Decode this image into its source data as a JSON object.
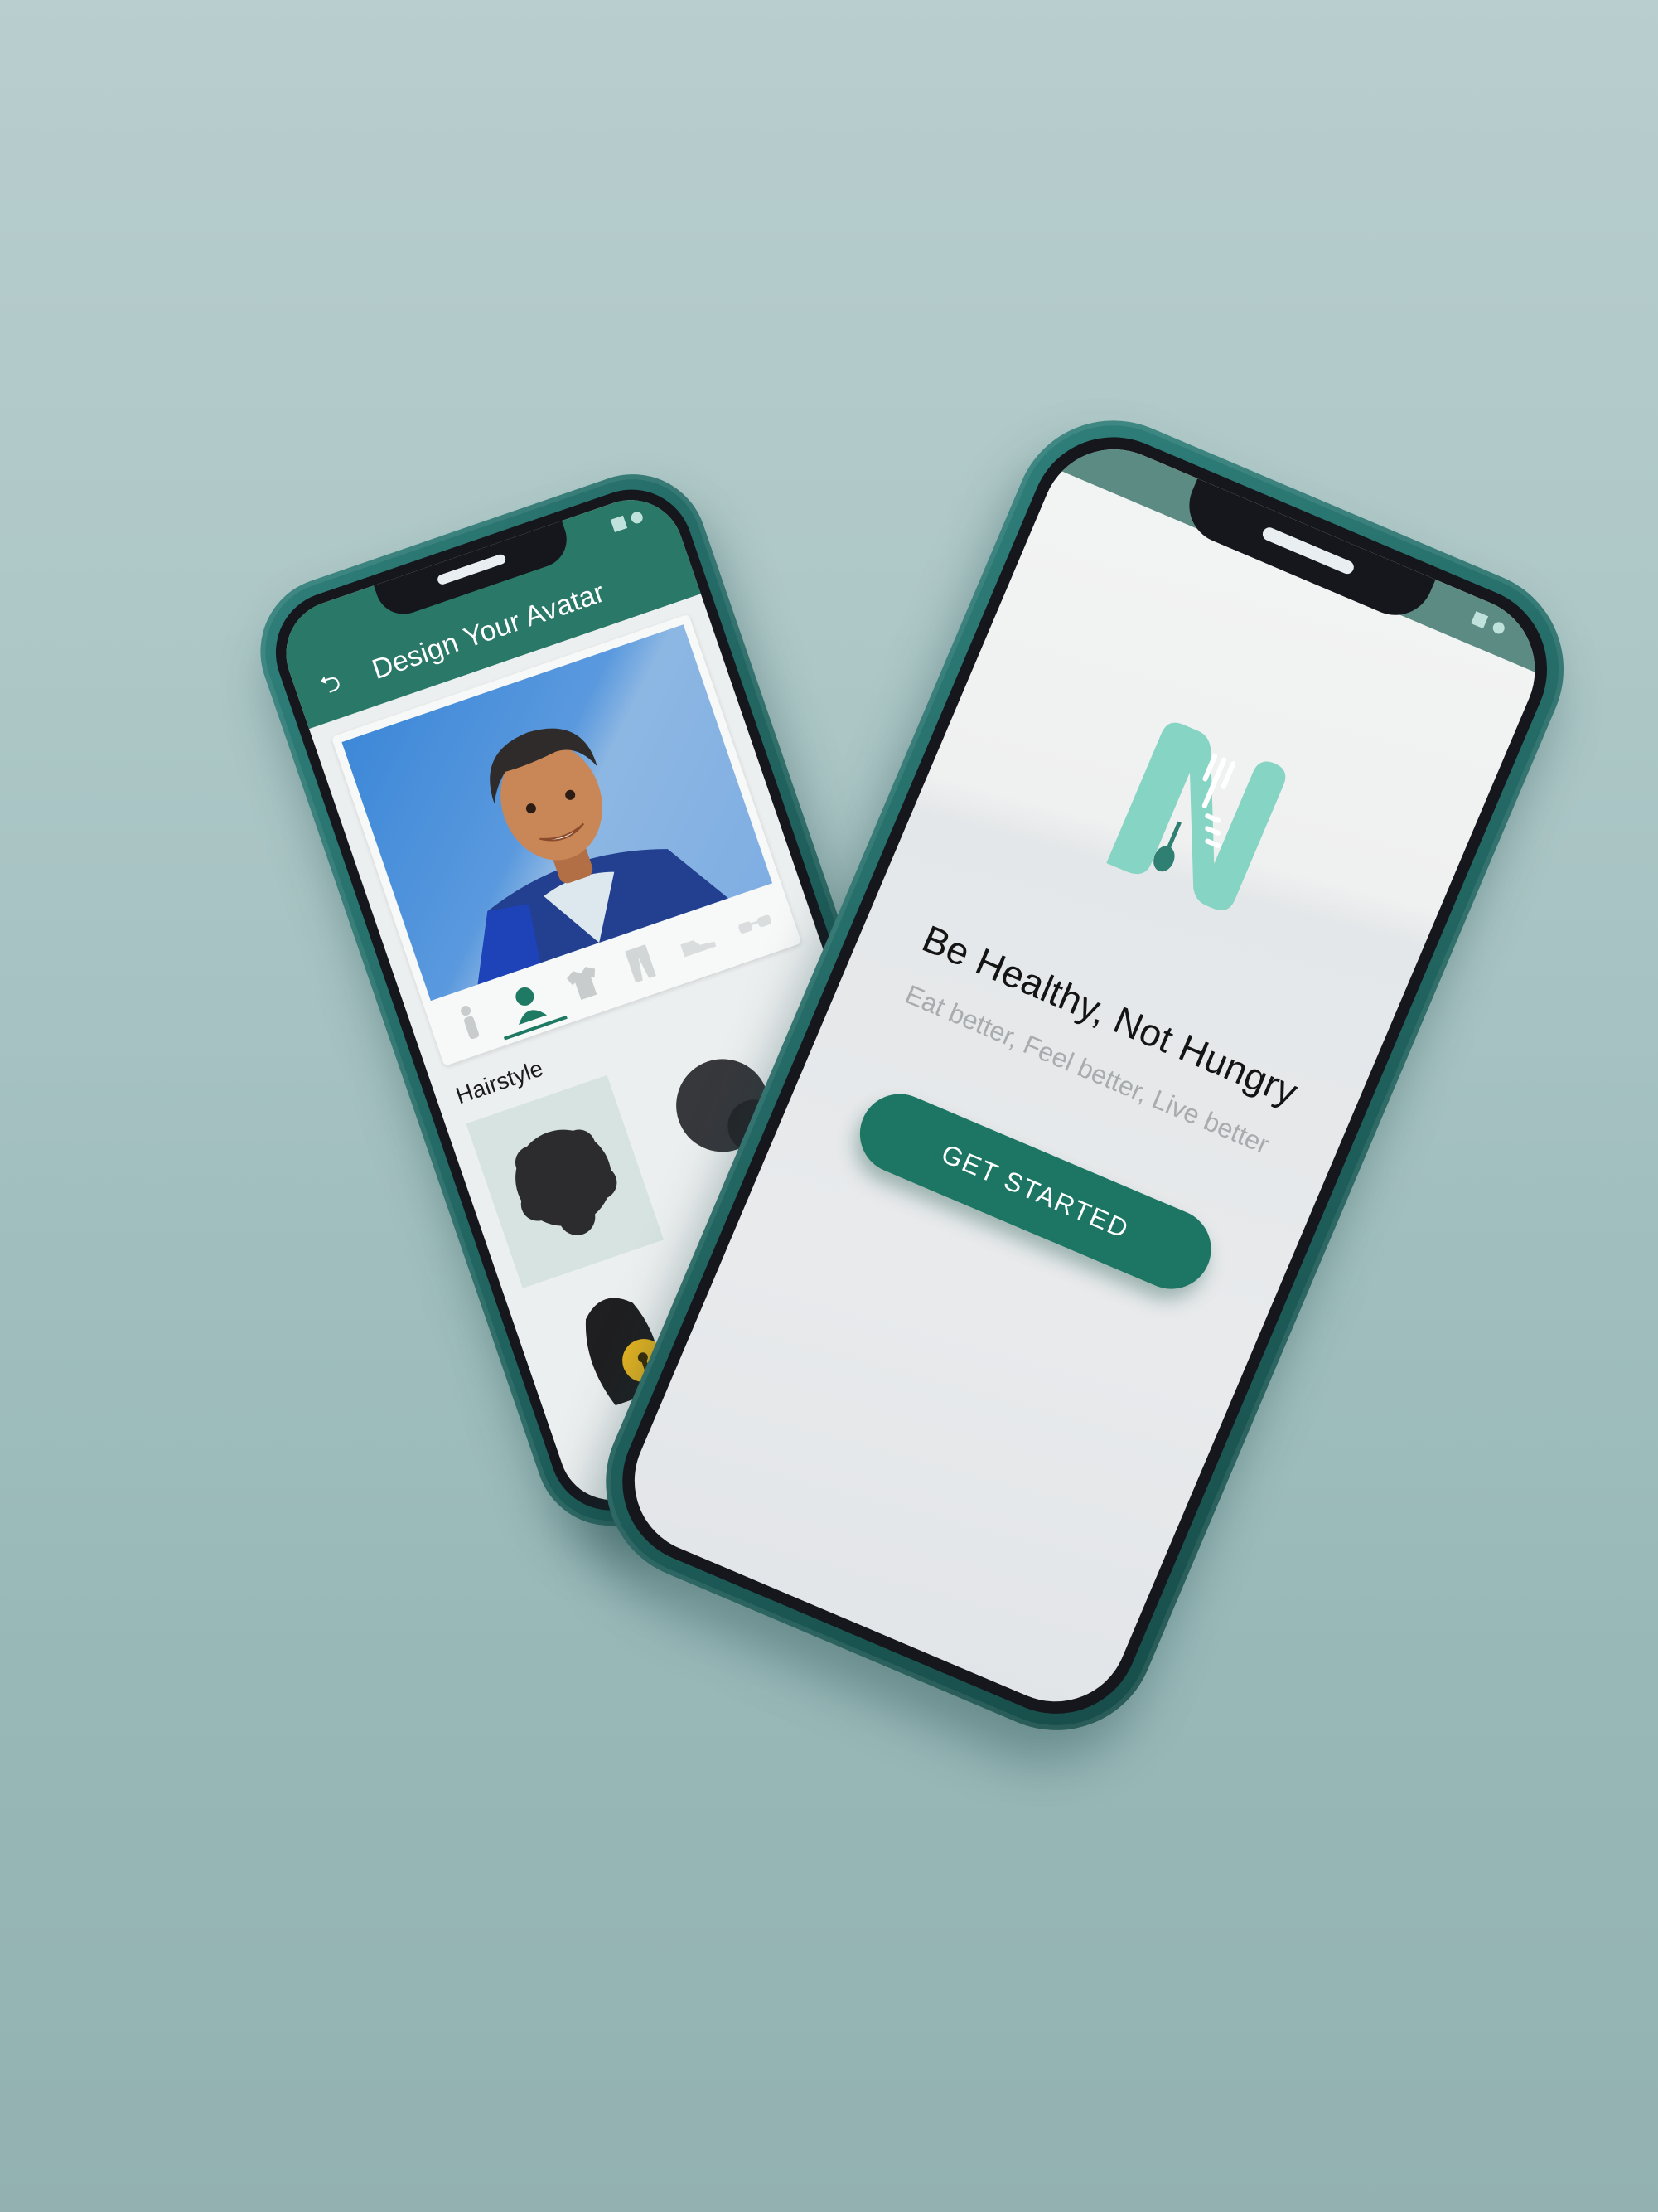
{
  "avatar_screen": {
    "title": "Design Your Avatar",
    "back_icon": "undo-icon",
    "tabs": [
      {
        "icon": "body-icon",
        "active": false
      },
      {
        "icon": "head-icon",
        "active": true
      },
      {
        "icon": "shirt-icon",
        "active": false
      },
      {
        "icon": "pants-icon",
        "active": false
      },
      {
        "icon": "shoes-icon",
        "active": false
      },
      {
        "icon": "glasses-icon",
        "active": false
      }
    ],
    "section_label": "Hairstyle",
    "hairstyles": [
      {
        "icon": "afro-hair-icon",
        "selected": true,
        "locked": false
      },
      {
        "icon": "afro-puff-hair-icon",
        "selected": false,
        "locked": false
      },
      {
        "icon": "long-hair-icon",
        "selected": false,
        "locked": true
      },
      {
        "icon": "curly-hair-icon",
        "selected": false,
        "locked": true
      }
    ]
  },
  "landing_screen": {
    "logo_icon": "n-logo-fork-spoon-ruler-icon",
    "headline": "Be Healthy, Not Hungry",
    "tagline": "Eat better,  Feel better, Live better",
    "cta_label": "GET STARTED"
  },
  "colors": {
    "brand": "#1c7663",
    "appbar": "#2a7867",
    "logo": "#86d4c4",
    "phone_case": "#20625e",
    "lock": "#e6b422"
  }
}
